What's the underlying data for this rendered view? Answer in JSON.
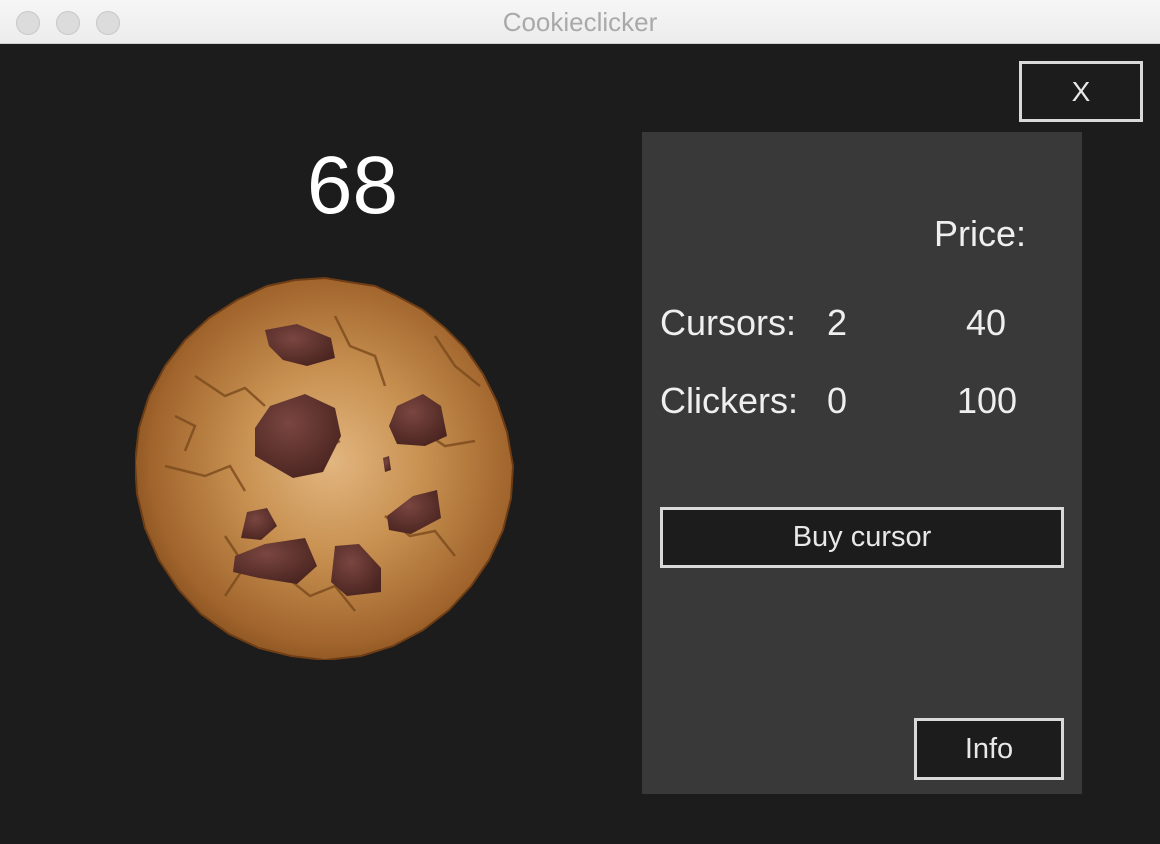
{
  "window": {
    "title": "Cookieclicker"
  },
  "toolbar": {
    "close_label": "X"
  },
  "game": {
    "cookie_count": "68",
    "cookie_icon": "cookie-icon"
  },
  "shop": {
    "price_header": "Price:",
    "items": [
      {
        "label": "Cursors:",
        "count": "2",
        "price": "40"
      },
      {
        "label": "Clickers:",
        "count": "0",
        "price": "100"
      }
    ],
    "buy_label": "Buy cursor",
    "info_label": "Info"
  },
  "colors": {
    "background": "#1c1c1c",
    "panel": "#393939",
    "button_border": "#d9d9d9",
    "text": "#efefef",
    "cookie_dough": "#b77a3b",
    "chocolate": "#5a2f2a"
  }
}
